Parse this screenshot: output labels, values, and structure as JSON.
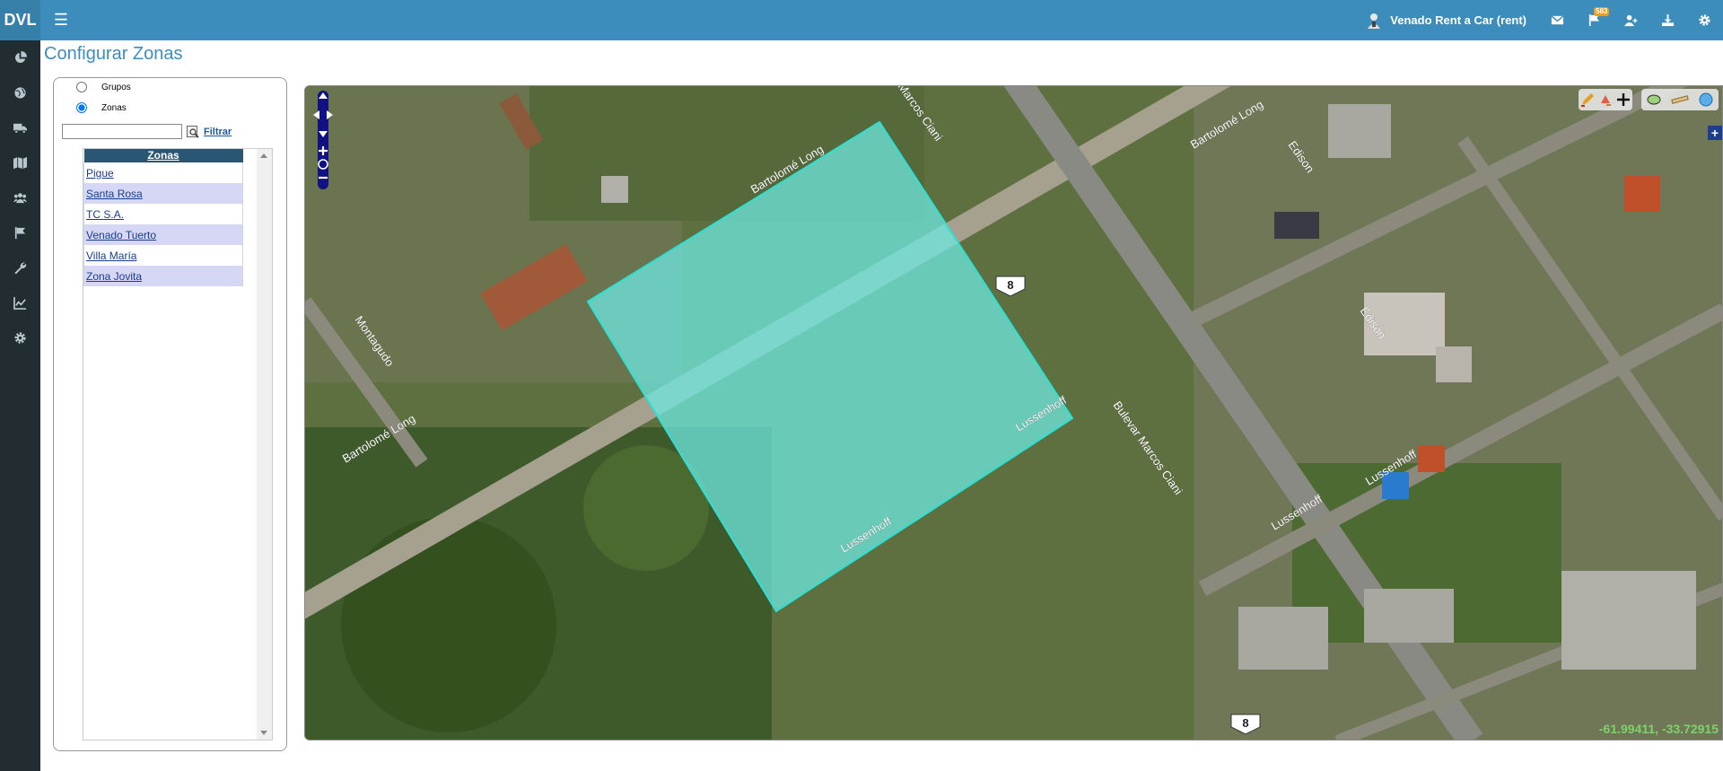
{
  "header": {
    "brand": "DVL",
    "user_name": "Venado Rent a Car (rent)",
    "notification_count": "583",
    "icons": [
      "envelope-icon",
      "flag-icon",
      "user-plus-icon",
      "download-icon",
      "gear-icon"
    ]
  },
  "sidebar": {
    "items": [
      {
        "icon": "pie-chart-icon"
      },
      {
        "icon": "globe-icon"
      },
      {
        "icon": "truck-icon"
      },
      {
        "icon": "map-icon"
      },
      {
        "icon": "users-icon"
      },
      {
        "icon": "flag-icon"
      },
      {
        "icon": "wrench-icon"
      },
      {
        "icon": "line-chart-icon"
      },
      {
        "icon": "cog-icon"
      }
    ]
  },
  "page": {
    "title": "Configurar Zonas"
  },
  "panel": {
    "radio_groups": "Grupos",
    "radio_zones": "Zonas",
    "selected_radio": "Zonas",
    "filter_value": "",
    "filter_label": "Filtrar",
    "list_header": "Zonas",
    "zones": [
      "Pigue",
      "Santa Rosa",
      "TC S.A.",
      "Venado Tuerto",
      "Villa María",
      "Zona Jovita"
    ]
  },
  "map": {
    "coordinates": "-61.99411, -33.72915",
    "route_shield": "8",
    "streets": [
      "Bartolomé Long",
      "Bartolomé Long",
      "Bartolomé Long",
      "Marcos Ciani",
      "Bulevar Marcos Ciani",
      "Montagudo",
      "Lussenhoff",
      "Lussenhoff",
      "Lussenhoff",
      "Lussenhoff",
      "Edison",
      "Edison"
    ],
    "zone_fill_color": "#6ee8e0",
    "controls": [
      "pan-up-icon",
      "pan-left-icon",
      "pan-right-icon",
      "pan-down-icon",
      "zoom-in-icon",
      "zoom-world-icon",
      "zoom-out-icon"
    ]
  }
}
